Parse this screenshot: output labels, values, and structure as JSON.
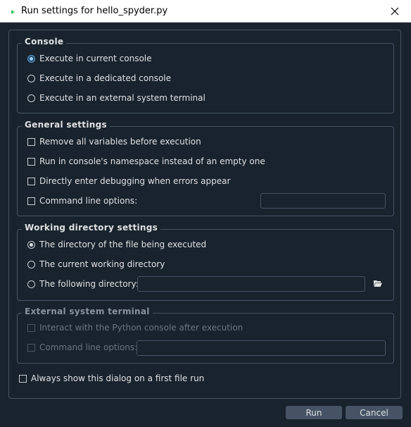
{
  "window": {
    "title": "Run settings for hello_spyder.py"
  },
  "console": {
    "title": "Console",
    "options": [
      "Execute in current console",
      "Execute in a dedicated console",
      "Execute in an external system terminal"
    ],
    "selected": "Execute in current console"
  },
  "general": {
    "title": "General settings",
    "options": [
      "Remove all variables before execution",
      "Run in console's namespace instead of an empty one",
      "Directly enter debugging when errors appear",
      "Command line options:"
    ],
    "command_line_value": ""
  },
  "working_dir": {
    "title": "Working directory settings",
    "options": [
      "The directory of the file being executed",
      "The current working directory",
      "The following directory:"
    ],
    "selected": "The directory of the file being executed",
    "directory_value": ""
  },
  "external": {
    "title": "External system terminal",
    "interact_label": "Interact with the Python console after execution",
    "cmd_label": "Command line options:",
    "cmd_value": ""
  },
  "always_show_label": "Always show this dialog on a first file run",
  "buttons": {
    "run": "Run",
    "cancel": "Cancel"
  },
  "colors": {
    "background": "#19232d",
    "border": "#455364",
    "button": "#455364",
    "accent": "#5a9fd4"
  }
}
